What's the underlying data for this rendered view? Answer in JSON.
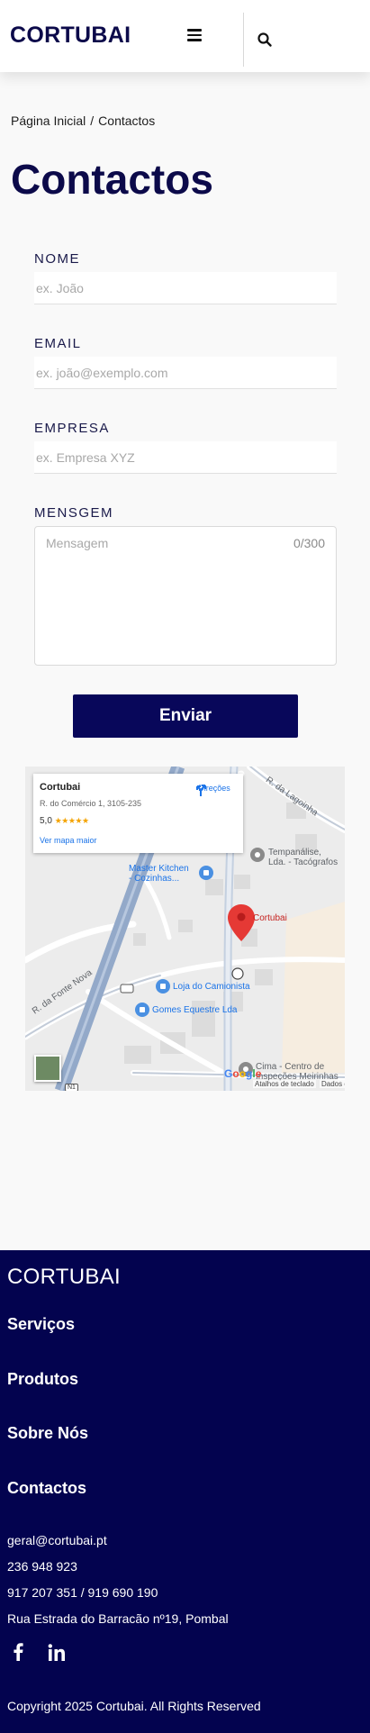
{
  "header": {
    "logo": "CORTUBAI",
    "menu_icon": "hamburger-menu-icon",
    "search_icon": "search-icon"
  },
  "breadcrumb": {
    "home": "Página Inicial",
    "separator": "/",
    "current": "Contactos"
  },
  "page_title": "Contactos",
  "form": {
    "name": {
      "label": "NOME",
      "placeholder": "ex. João",
      "value": ""
    },
    "email": {
      "label": "EMAIL",
      "placeholder": "ex. joão@exemplo.com",
      "value": ""
    },
    "company": {
      "label": "EMPRESA",
      "placeholder": "ex. Empresa XYZ",
      "value": ""
    },
    "message": {
      "label": "MENSGEM",
      "placeholder": "Mensagem",
      "value": "",
      "counter": "0/300"
    },
    "submit_label": "Enviar"
  },
  "map": {
    "place_card": {
      "title": "Cortubai",
      "address": "R. do Comércio 1, 3105-235",
      "rating": "5,0",
      "stars": "★★★★★",
      "larger_map_link": "Ver mapa maior",
      "directions_label": "Direções",
      "directions_icon": "directions-icon"
    },
    "markers": {
      "main": "Cortubai",
      "master_kitchen": [
        "Master Kitchen",
        "- Cozinhas..."
      ],
      "tempanalise": [
        "Tempanálise,",
        "Lda. - Tacógrafos"
      ],
      "loja_camionista": "Loja do Camionista",
      "gomes_equestre": "Gomes Equestre Lda",
      "cima": [
        "Cima - Centro de",
        "Inspeções Meirinhas"
      ]
    },
    "streets": {
      "lagoinha": "R. da Lagoinha",
      "fonte_nova": "R. da Fonte Nova",
      "road_code": "N1"
    },
    "google_logo": "Google",
    "attribution_keyboard": "Atalhos de teclado",
    "attribution_data": "Dados d"
  },
  "footer": {
    "logo": "CORTUBAI",
    "nav": [
      "Serviços",
      "Produtos",
      "Sobre Nós",
      "Contactos"
    ],
    "email": "geral@cortubai.pt",
    "phone": "236 948 923",
    "mobile": "917 207 351 / 919 690 190",
    "address": "Rua Estrada do Barracão nº19, Pombal",
    "social_icons": [
      "facebook-icon",
      "linkedin-icon"
    ],
    "copyright": "Copyright 2025 Cortubai. All Rights Reserved"
  },
  "colors": {
    "brand_navy": "#0c0a4a",
    "button": "#08075a",
    "footer_bg": "#03034f",
    "map_pin": "#e53935",
    "map_link": "#1a73e8"
  }
}
